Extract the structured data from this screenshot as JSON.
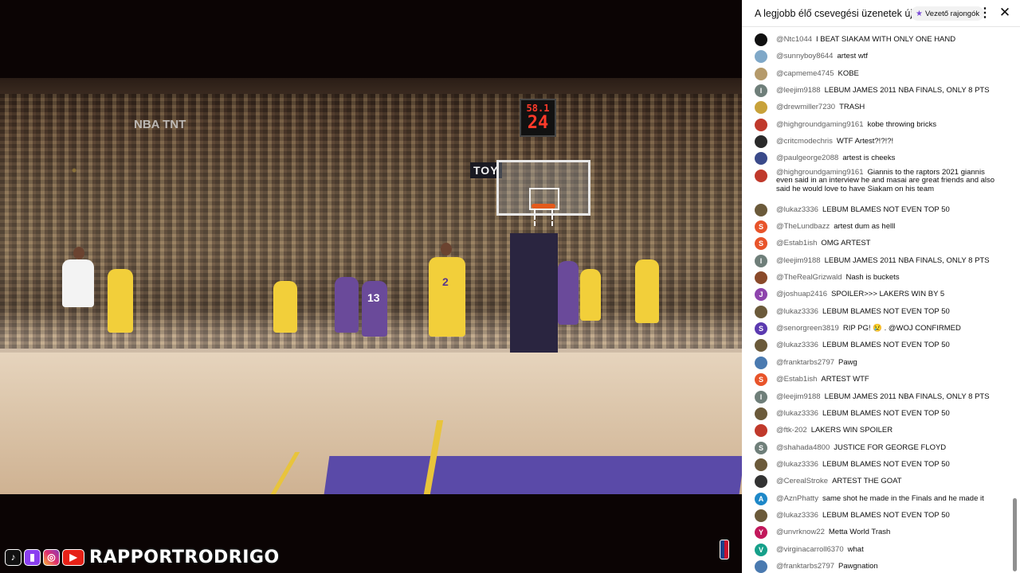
{
  "video": {
    "shot_clock_game": "58.1",
    "shot_clock_shot": "24",
    "arena_banner": "TOY",
    "broadcast_logo": "NBA TNT",
    "jersey_numbers": [
      "2",
      "13"
    ]
  },
  "brand": {
    "name": "RAPPORTRODRIGO",
    "icons": [
      "tiktok-icon",
      "twitch-icon",
      "instagram-icon",
      "youtube-icon"
    ]
  },
  "chat": {
    "title": "A legjobb élő csevegési üzenetek új...",
    "fan_chip_label": "Vezető rajongók",
    "messages": [
      {
        "author": "@Ntc1044",
        "text": "I BEAT SIAKAM WITH ONLY ONE HAND",
        "avatar": "",
        "color": "#111111"
      },
      {
        "author": "@sunnyboy8644",
        "text": "artest wtf",
        "avatar": "",
        "color": "#7fa8c8"
      },
      {
        "author": "@capmeme4745",
        "text": "KOBE",
        "avatar": "",
        "color": "#b59a6a"
      },
      {
        "author": "@leejim9188",
        "text": "LEBUM JAMES 2011 NBA FINALS, ONLY 8 PTS",
        "avatar": "l",
        "color": "#6f7f7a"
      },
      {
        "author": "@drewmiller7230",
        "text": "TRASH",
        "avatar": "",
        "color": "#c8a23a"
      },
      {
        "author": "@highgroundgaming9161",
        "text": "kobe throwing bricks",
        "avatar": "",
        "color": "#c0392b"
      },
      {
        "author": "@critcmodechris",
        "text": "WTF Artest?!?!?!",
        "avatar": "",
        "color": "#2a2a2a"
      },
      {
        "author": "@paulgeorge2088",
        "text": "artest is cheeks",
        "avatar": "",
        "color": "#3a4a8a"
      },
      {
        "author": "@highgroundgaming9161",
        "text": "Giannis to the raptors 2021 giannis even said in an interview he and masai are great friends and also said he would love to have Siakam on his team",
        "avatar": "",
        "color": "#c0392b"
      },
      {
        "author": "@lukaz3336",
        "text": "LEBUM BLAMES NOT EVEN TOP 50",
        "avatar": "",
        "color": "#6b5a3a"
      },
      {
        "author": "@TheLundbazz",
        "text": "artest dum as helll",
        "avatar": "S",
        "color": "#e8542a"
      },
      {
        "author": "@Estab1ish",
        "text": "OMG ARTEST",
        "avatar": "S",
        "color": "#e8542a"
      },
      {
        "author": "@leejim9188",
        "text": "LEBUM JAMES 2011 NBA FINALS, ONLY 8 PTS",
        "avatar": "l",
        "color": "#6f7f7a"
      },
      {
        "author": "@TheRealGrizwald",
        "text": "Nash is buckets",
        "avatar": "",
        "color": "#8a4a2a"
      },
      {
        "author": "@joshuap2416",
        "text": "SPOILER>>> LAKERS WIN BY 5",
        "avatar": "J",
        "color": "#8e44ad"
      },
      {
        "author": "@lukaz3336",
        "text": "LEBUM BLAMES NOT EVEN TOP 50",
        "avatar": "",
        "color": "#6b5a3a"
      },
      {
        "author": "@senorgreen3819",
        "text": "RIP PG! 😢 . @WOJ CONFIRMED",
        "avatar": "S",
        "color": "#5b3ab0"
      },
      {
        "author": "@lukaz3336",
        "text": "LEBUM BLAMES NOT EVEN TOP 50",
        "avatar": "",
        "color": "#6b5a3a"
      },
      {
        "author": "@franktarbs2797",
        "text": "Pawg",
        "avatar": "",
        "color": "#4a7ab0"
      },
      {
        "author": "@Estab1ish",
        "text": "ARTEST WTF",
        "avatar": "S",
        "color": "#e8542a"
      },
      {
        "author": "@leejim9188",
        "text": "LEBUM JAMES 2011 NBA FINALS, ONLY 8 PTS",
        "avatar": "l",
        "color": "#6f7f7a"
      },
      {
        "author": "@lukaz3336",
        "text": "LEBUM BLAMES NOT EVEN TOP 50",
        "avatar": "",
        "color": "#6b5a3a"
      },
      {
        "author": "@ftk-202",
        "text": "LAKERS WIN SPOILER",
        "avatar": "",
        "color": "#c0392b"
      },
      {
        "author": "@shahada4800",
        "text": "JUSTICE FOR GEORGE FLOYD",
        "avatar": "S",
        "color": "#6f7f7a"
      },
      {
        "author": "@lukaz3336",
        "text": "LEBUM BLAMES NOT EVEN TOP 50",
        "avatar": "",
        "color": "#6b5a3a"
      },
      {
        "author": "@CerealStroke",
        "text": "ARTEST THE GOAT",
        "avatar": "",
        "color": "#333333"
      },
      {
        "author": "@AznPhatty",
        "text": "same shot he made in the Finals and he made it",
        "avatar": "A",
        "color": "#1e88c8"
      },
      {
        "author": "@lukaz3336",
        "text": "LEBUM BLAMES NOT EVEN TOP 50",
        "avatar": "",
        "color": "#6b5a3a"
      },
      {
        "author": "@unvrknow22",
        "text": "Metta World Trash",
        "avatar": "Y",
        "color": "#c2185b"
      },
      {
        "author": "@virginacarroll6370",
        "text": "what",
        "avatar": "V",
        "color": "#16a08a"
      },
      {
        "author": "@franktarbs2797",
        "text": "Pawgnation",
        "avatar": "",
        "color": "#4a7ab0"
      }
    ]
  }
}
